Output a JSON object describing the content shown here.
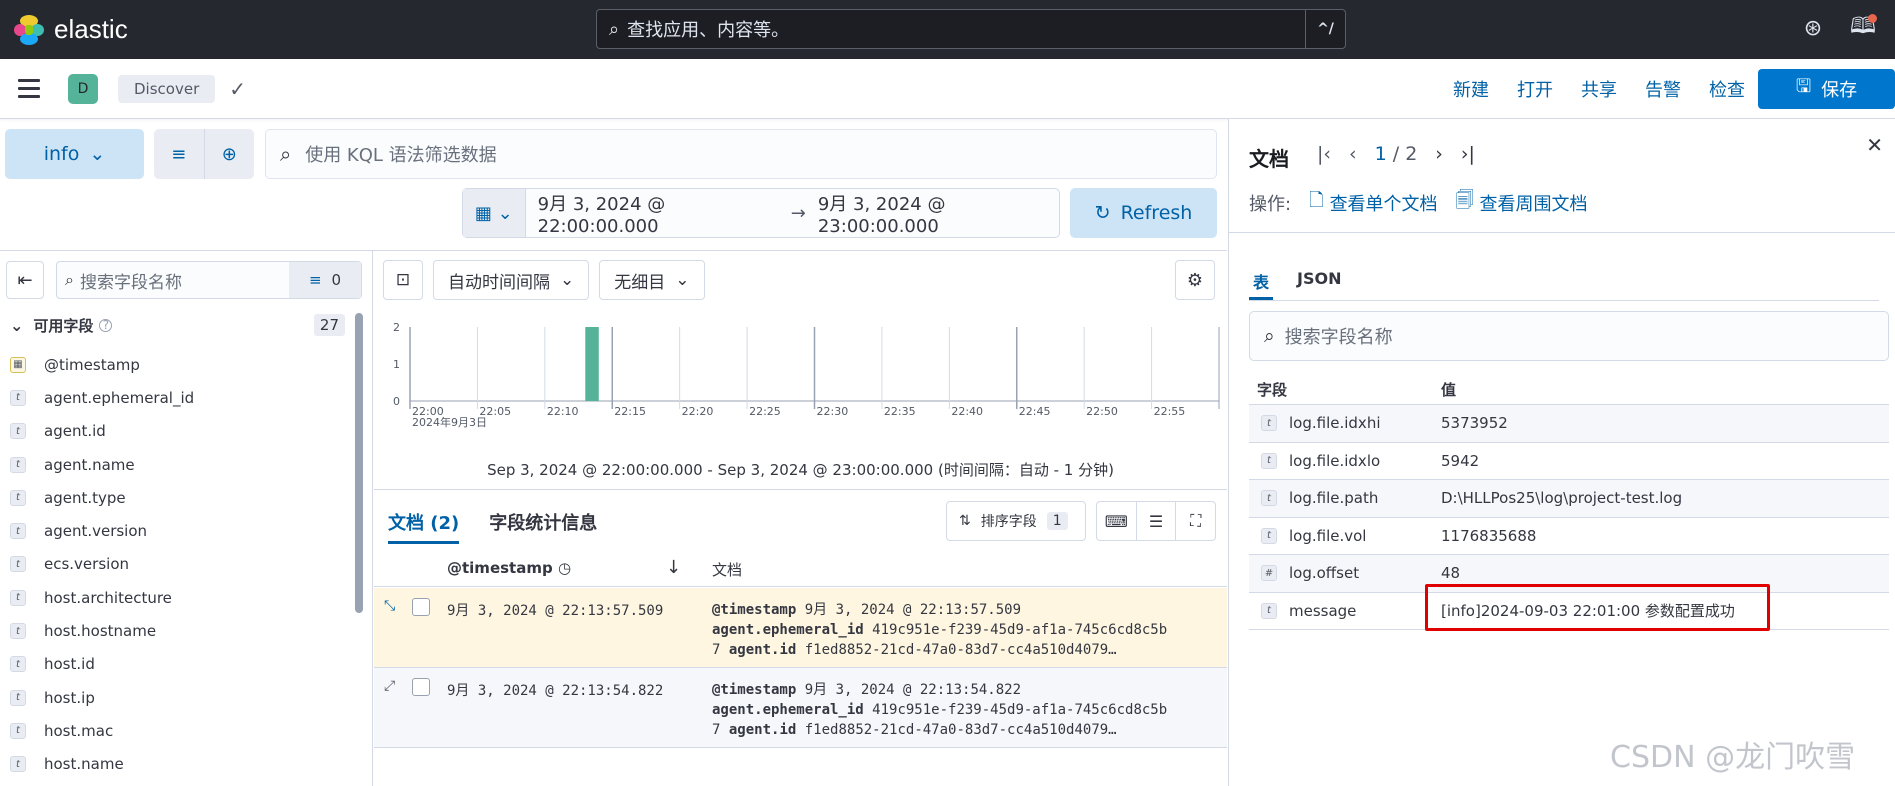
{
  "app": {
    "brand": "elastic",
    "search_placeholder": "查找应用、内容等。",
    "shortcut": "^/"
  },
  "nav": {
    "avatar": "D",
    "breadcrumb": "Discover",
    "links": [
      "新建",
      "打开",
      "共享",
      "告警",
      "检查"
    ],
    "save": "保存"
  },
  "query": {
    "data_view": "info",
    "kql_placeholder": "使用 KQL 语法筛选数据"
  },
  "time": {
    "start": "9月 3, 2024 @ 22:00:00.000",
    "end": "9月 3, 2024 @ 23:00:00.000",
    "refresh": "Refresh"
  },
  "sidebar": {
    "search_placeholder": "搜索字段名称",
    "filter_count": "0",
    "section_title": "可用字段",
    "section_count": "27",
    "fields": [
      {
        "name": "@timestamp",
        "type": "date"
      },
      {
        "name": "agent.ephemeral_id",
        "type": "t"
      },
      {
        "name": "agent.id",
        "type": "t"
      },
      {
        "name": "agent.name",
        "type": "t"
      },
      {
        "name": "agent.type",
        "type": "t"
      },
      {
        "name": "agent.version",
        "type": "t"
      },
      {
        "name": "ecs.version",
        "type": "t"
      },
      {
        "name": "host.architecture",
        "type": "t"
      },
      {
        "name": "host.hostname",
        "type": "t"
      },
      {
        "name": "host.id",
        "type": "t"
      },
      {
        "name": "host.ip",
        "type": "t"
      },
      {
        "name": "host.mac",
        "type": "t"
      },
      {
        "name": "host.name",
        "type": "t"
      }
    ]
  },
  "toolbar": {
    "interval": "自动时间间隔",
    "breakdown": "无细目"
  },
  "chart_data": {
    "type": "bar",
    "x_ticks": [
      "22:00",
      "22:05",
      "22:10",
      "22:15",
      "22:20",
      "22:25",
      "22:30",
      "22:35",
      "22:40",
      "22:45",
      "22:50",
      "22:55"
    ],
    "x_sublabel": "2024年9月3日",
    "y_ticks": [
      "0",
      "1",
      "2"
    ],
    "ylim": [
      0,
      2
    ],
    "bars": [
      {
        "x": "22:13",
        "value": 2
      }
    ],
    "bar_color": "#54b399",
    "caption": "Sep 3, 2024 @ 22:00:00.000 - Sep 3, 2024 @ 23:00:00.000  (时间间隔：自动 - 1 分钟)"
  },
  "docs_tabs": {
    "docs": "文档 (2)",
    "stats": "字段统计信息"
  },
  "sort": {
    "label": "排序字段",
    "count": "1"
  },
  "table": {
    "col_ts": "@timestamp",
    "col_doc": "文档",
    "rows": [
      {
        "ts": "9月 3, 2024 @ 22:13:57.509",
        "line1": "9月 3, 2024 @ 22:13:57.509",
        "eph": "419c951e-f239-45d9-af1a-745c6cd8c5b",
        "tail": "7",
        "agent": "f1ed8852-21cd-47a0-83d7-cc4a510d4079…"
      },
      {
        "ts": "9月 3, 2024 @ 22:13:54.822",
        "line1": "9月 3, 2024 @ 22:13:54.822",
        "eph": "419c951e-f239-45d9-af1a-745c6cd8c5b",
        "tail": "7",
        "agent": "f1ed8852-21cd-47a0-83d7-cc4a510d4079…"
      }
    ]
  },
  "panel": {
    "title": "文档",
    "page_cur": "1",
    "page_total": "2",
    "ops_label": "操作:",
    "op1": "查看单个文档",
    "op2": "查看周围文档",
    "tab_table": "表",
    "tab_json": "JSON",
    "search_placeholder": "搜索字段名称",
    "col_field": "字段",
    "col_value": "值",
    "rows": [
      {
        "field": "log.file.idxhi",
        "type": "t",
        "value": "5373952"
      },
      {
        "field": "log.file.idxlo",
        "type": "t",
        "value": "5942"
      },
      {
        "field": "log.file.path",
        "type": "t",
        "value": "D:\\HLLPos25\\log\\project-test.log"
      },
      {
        "field": "log.file.vol",
        "type": "t",
        "value": "1176835688"
      },
      {
        "field": "log.offset",
        "type": "#",
        "value": "48"
      },
      {
        "field": "message",
        "type": "t",
        "value": "[info]2024-09-03 22:01:00 参数配置成功"
      }
    ]
  },
  "watermark": "CSDN @龙门吹雪"
}
